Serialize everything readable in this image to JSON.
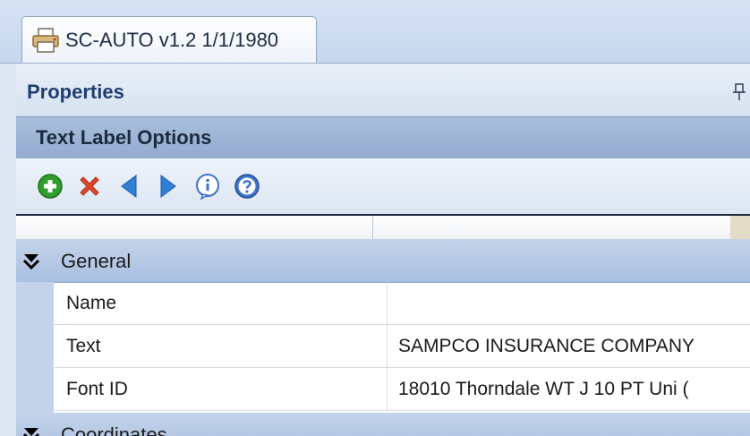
{
  "tab": {
    "title": "SC-AUTO v1.2 1/1/1980",
    "icon": "printer-icon"
  },
  "properties": {
    "title": "Properties",
    "pin_icon": "pin-icon"
  },
  "group": {
    "title": "Text Label Options"
  },
  "toolbar": {
    "buttons": [
      {
        "name": "add-button",
        "icon": "add-icon",
        "color": "#2e9e2e"
      },
      {
        "name": "delete-button",
        "icon": "delete-icon",
        "color": "#e0452a"
      },
      {
        "name": "previous-button",
        "icon": "arrow-left-icon",
        "color": "#2f7fd6"
      },
      {
        "name": "next-button",
        "icon": "arrow-right-icon",
        "color": "#2f7fd6"
      },
      {
        "name": "info-button",
        "icon": "info-icon",
        "color": "#3f72c8"
      },
      {
        "name": "help-button",
        "icon": "help-icon",
        "color": "#3f72c8"
      }
    ]
  },
  "grid": {
    "categories": [
      {
        "label": "General",
        "rows": [
          {
            "name": "Name",
            "value": ""
          },
          {
            "name": "Text",
            "value": "SAMPCO INSURANCE COMPANY"
          },
          {
            "name": "Font ID",
            "value": "18010 Thorndale WT J 10 PT Uni ("
          }
        ]
      },
      {
        "label": "Coordinates",
        "rows": []
      }
    ]
  }
}
